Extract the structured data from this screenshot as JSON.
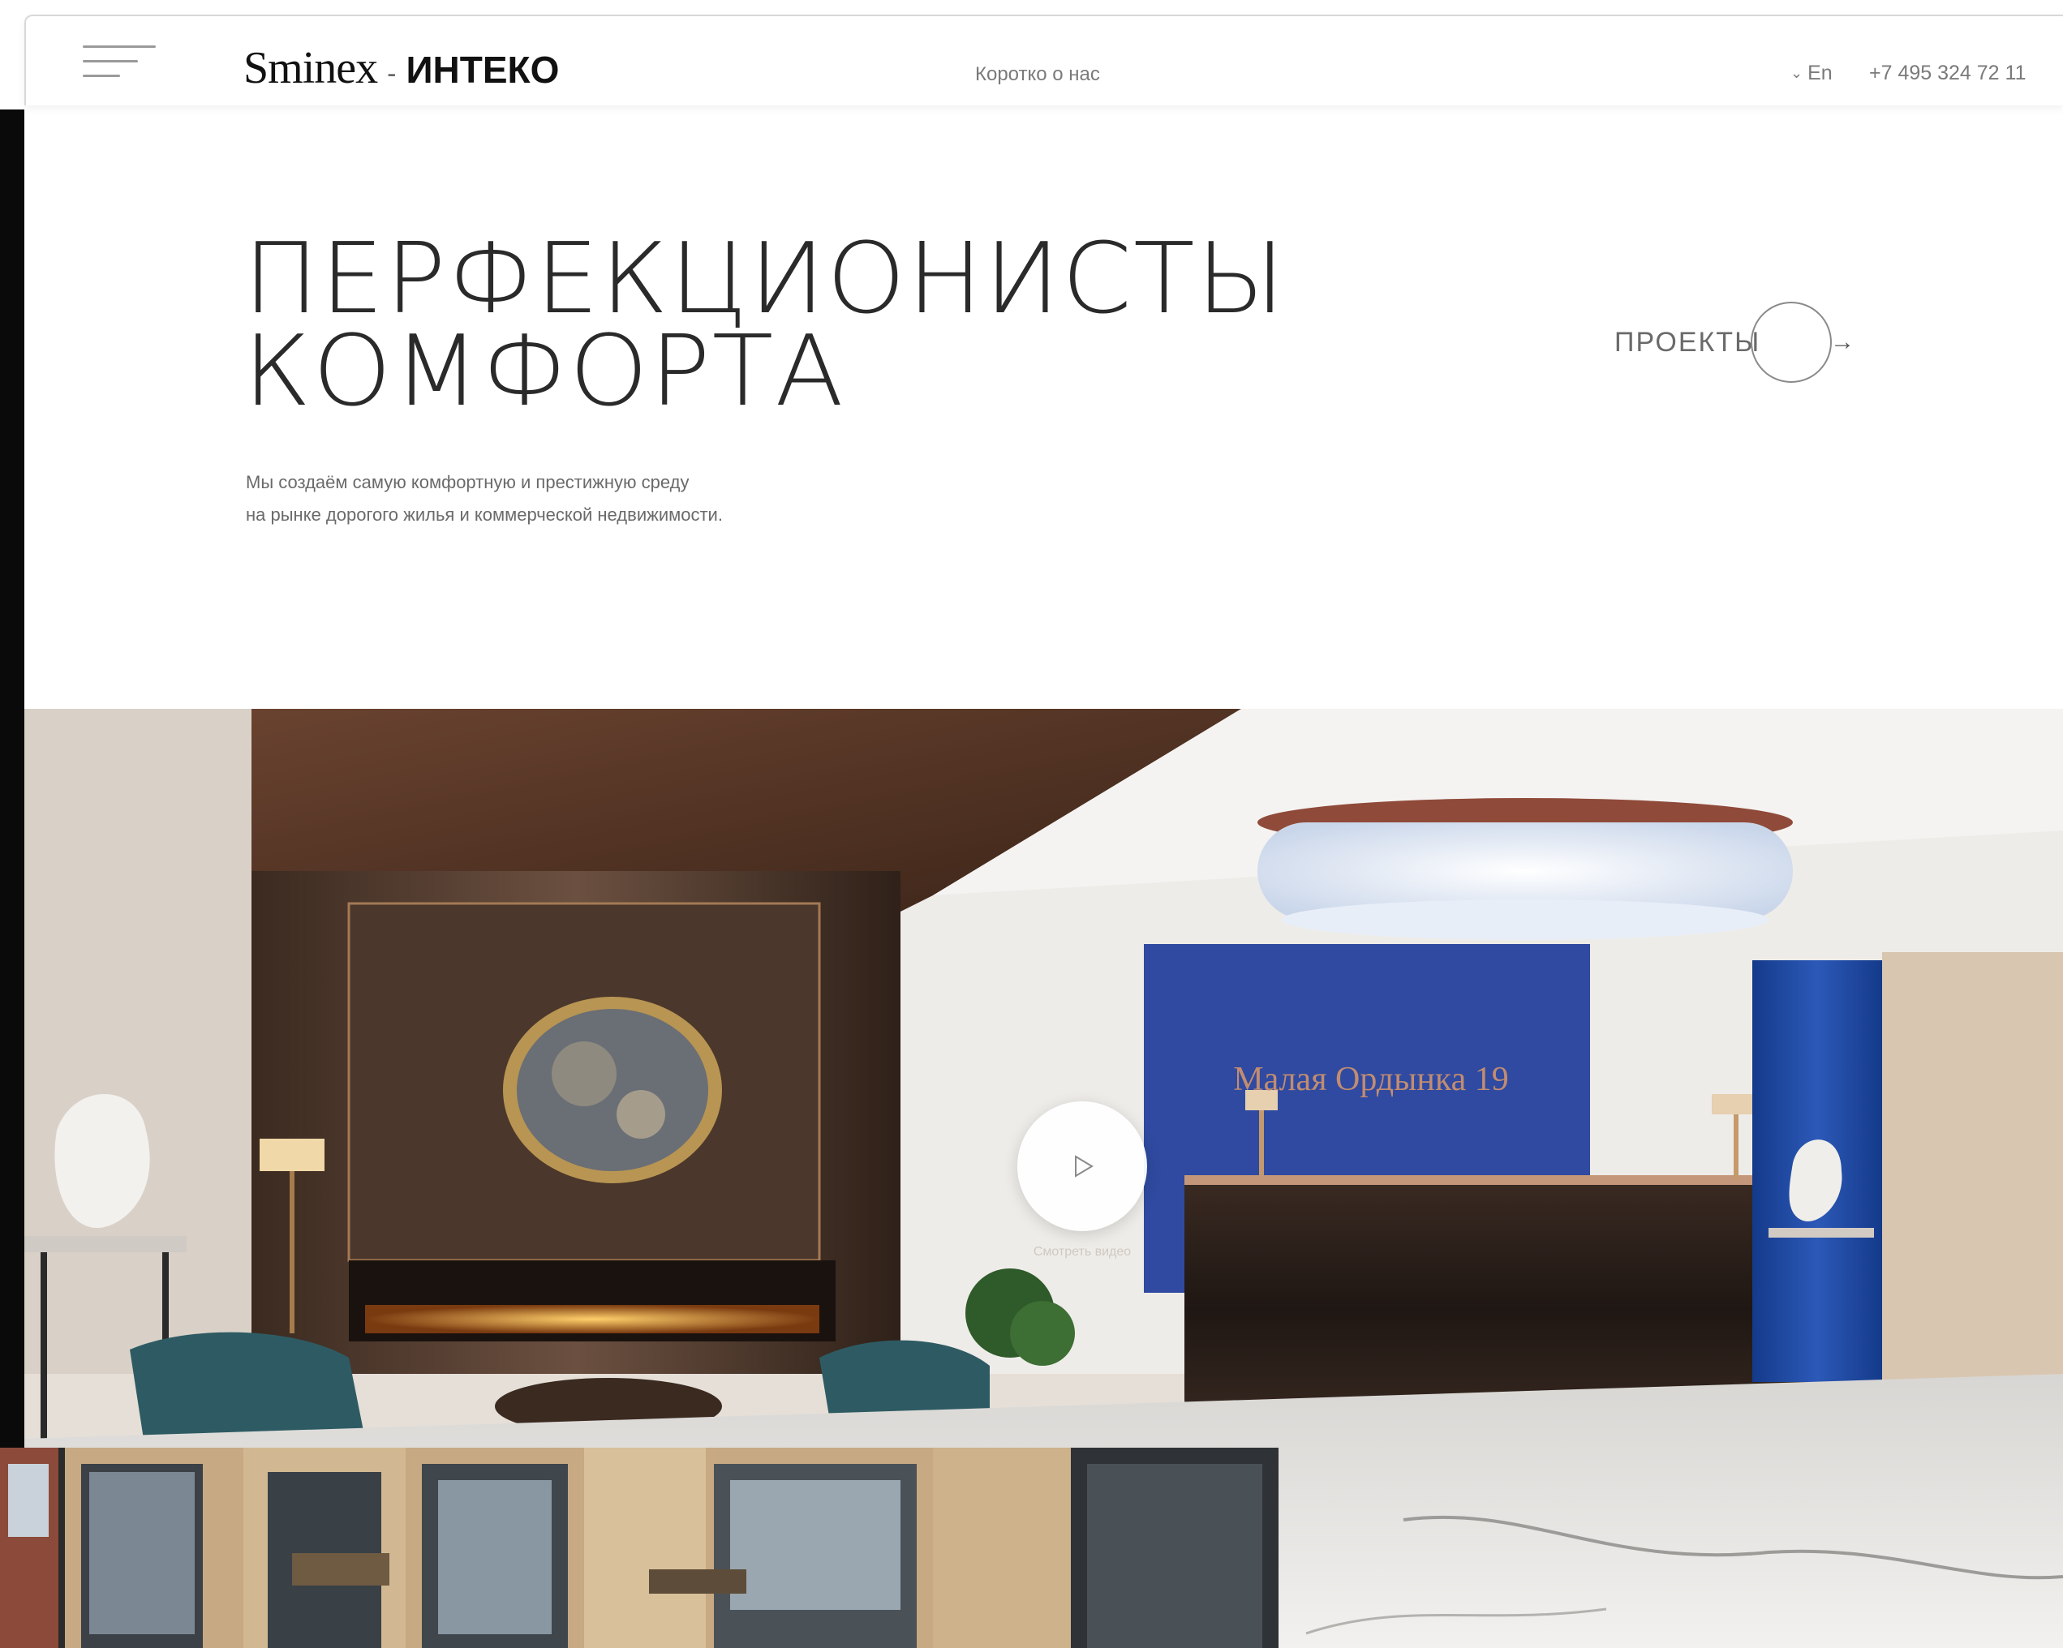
{
  "header": {
    "logo_brand_a": "Sminex",
    "logo_separator": "-",
    "logo_brand_b": "ИНТЕКО",
    "nav_about": "Коротко о нас",
    "lang_label": "En",
    "phone": "+7 495 324 72 11"
  },
  "hero": {
    "title_line1": "ПЕРФЕКЦИОНИСТЫ",
    "title_line2": "КОМФОРТА",
    "desc_line1": "Мы создаём самую комфортную и престижную среду",
    "desc_line2": "на рынке дорогого жилья и коммерческой недвижимости.",
    "projects_label": "ПРОЕКТЫ",
    "projects_arrow": "→"
  },
  "media": {
    "play_caption": "Смотреть видео",
    "reception_sign": "Малая Ордынка 19"
  },
  "icons": {
    "menu": "hamburger-icon",
    "lang_chevron": "chevron-down-icon",
    "projects": "arrow-right-icon",
    "play": "play-icon"
  }
}
